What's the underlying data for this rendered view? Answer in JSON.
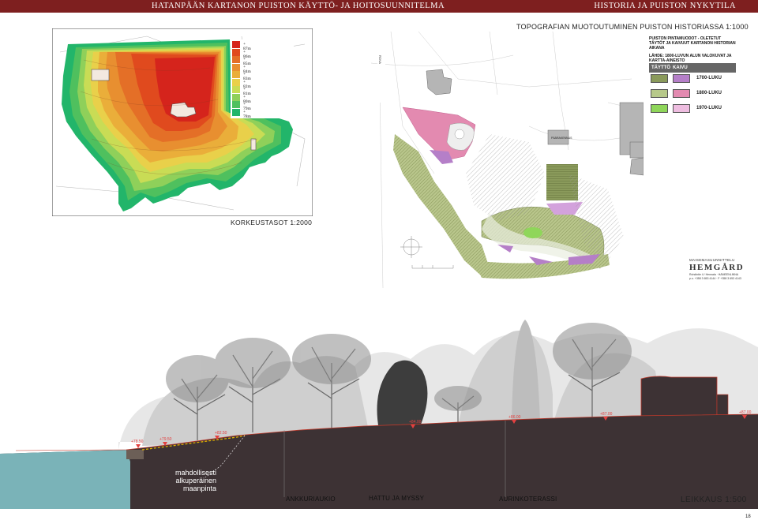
{
  "header": {
    "left_title": "HATANPÄÄN KARTANON PUISTON KÄYTTÖ- JA HOITOSUUNNITELMA",
    "right_title": "HISTORIA JA PUISTON NYKYTILA"
  },
  "elevation_map": {
    "title": "KORKEUSTASOT 1:2000",
    "legend": [
      {
        "label": "+ 87m",
        "color": "#d5241c"
      },
      {
        "label": "+ 86m",
        "color": "#e04a1e"
      },
      {
        "label": "+ 85m",
        "color": "#e46f27"
      },
      {
        "label": "+ 84m",
        "color": "#e88f30"
      },
      {
        "label": "+ 83m",
        "color": "#eaae3a"
      },
      {
        "label": "+ 82m",
        "color": "#e9d04a"
      },
      {
        "label": "+ 81m",
        "color": "#c9dc55"
      },
      {
        "label": "+ 80m",
        "color": "#8fd05a"
      },
      {
        "label": "+ 79m",
        "color": "#4fc05e"
      },
      {
        "label": "+ 78m",
        "color": "#22b56a"
      }
    ]
  },
  "topo_plan": {
    "title": "TOPOGRAFIAN MUOTOUTUMINEN PUISTON HISTORIASSA 1:1000",
    "legend_heading": "PUISTON PINTAMUODOT - OLETETUT TÄYTÖT JA KAIVUUT KARTANON HISTORIAN AIKANA",
    "legend_source": "LÄHDE: 1800-LUVUN ALUN VALOKUVAT JA KARTTA-AINEISTO",
    "col_fill": "TÄYTTÖ",
    "col_dig": "KAIVU",
    "eras": [
      {
        "label": "1700-LUKU",
        "fill_color": "#8a9a5b",
        "dig_color": "#b57fc8"
      },
      {
        "label": "1800-LUKU",
        "fill_color": "#b7c98a",
        "dig_color": "#e38ab0"
      },
      {
        "label": "1970-LUKU",
        "fill_color": "#8fd65a",
        "dig_color": "#eebde0"
      }
    ],
    "road_label": "ROVA",
    "building_label": "PÄÄRAKENNUS",
    "firm_line1": "MAISEMASUUNNITTELU",
    "firm_name": "HEMGÅRD",
    "firm_line3": "Rohdintie 4 / Hennala · HÄMEENLINNA",
    "firm_line4": "p.o. +358 3 653 4144 · F +358 3 653 4143"
  },
  "section": {
    "title": "LEIKKAUS 1:500",
    "ground_color": "#3d3234",
    "water_color": "#7ab3b8",
    "original_surface_note": [
      "mahdollisesti",
      "alkuperäinen",
      "maanpinta"
    ],
    "area_labels": [
      "ANKKURIAUKIO",
      "HATTU JA MYSSY",
      "AURINKOTERASSI"
    ],
    "levels": [
      "+78.50",
      "+79.50",
      "+82.50",
      "+84.00",
      "+86.00",
      "+87.00",
      "+87.00"
    ]
  },
  "page_number": "18"
}
